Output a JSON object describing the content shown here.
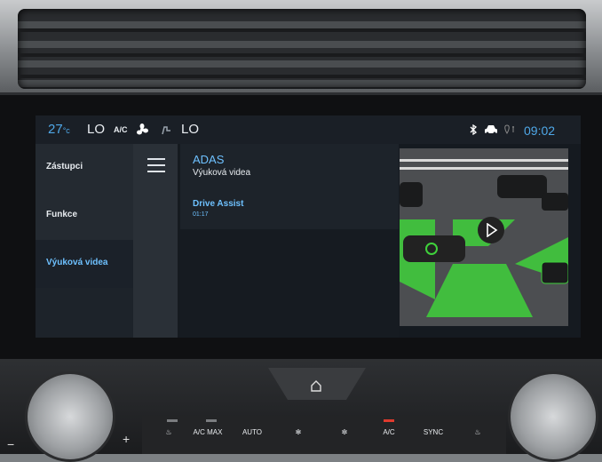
{
  "status_bar": {
    "temperature": "27",
    "temperature_unit": "°c",
    "fan_level_left": "LO",
    "ac_label": "A/C",
    "fan_level_right": "LO",
    "time": "09:02"
  },
  "sidebar": {
    "items": [
      {
        "label": "Zástupci",
        "active": false
      },
      {
        "label": "Funkce",
        "active": false
      },
      {
        "label": "Výuková videa",
        "active": true
      }
    ]
  },
  "content": {
    "section_title": "ADAS",
    "section_subtitle": "Výuková videa",
    "video": {
      "title": "Drive Assist",
      "duration": "01:17"
    }
  },
  "console": {
    "controls": [
      "",
      "A/C MAX",
      "AUTO",
      "",
      "",
      "A/C",
      "SYNC",
      ""
    ]
  },
  "colors": {
    "accent": "#4fa8e8",
    "green": "#3fd13b"
  }
}
